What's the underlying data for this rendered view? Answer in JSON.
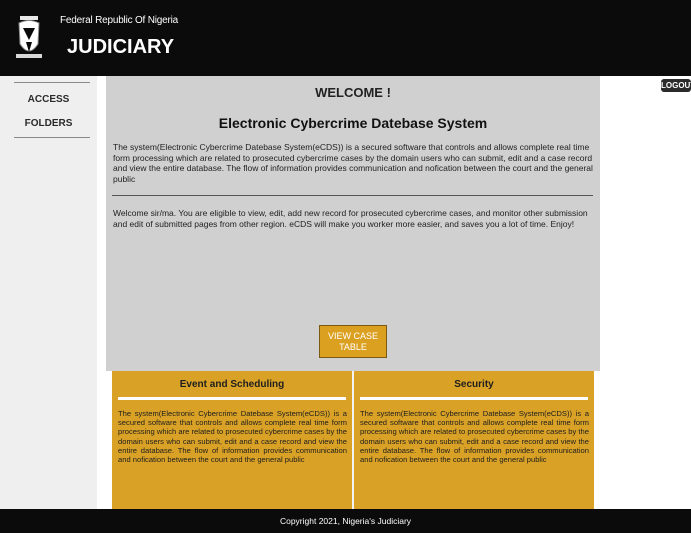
{
  "header": {
    "republic": "Federal Republic Of Nigeria",
    "brand": "JUDICIARY",
    "crest_icon": "coat-of-arms-icon"
  },
  "sidebar": {
    "items": [
      {
        "label": "ACCESS"
      },
      {
        "label": "FOLDERS"
      }
    ]
  },
  "logout_label": "LOGOUT",
  "main": {
    "welcome": "WELCOME !",
    "system_title": "Electronic Cybercrime Datebase System",
    "description": "The system(Electronic Cybercrime Datebase System(eCDS)) is a secured software that controls and allows complete real time form processing which are related to prosecuted cybercrime cases by the domain users who can submit, edit and a case record and view the entire database. The flow of information provides communication and nofication between the court and the general public",
    "welcome_message": "Welcome sir/ma. You are eligible to view, edit, add new record for prosecuted cybercrime cases, and monitor other submission and edit of submitted pages from other region. eCDS will make you worker more easier, and saves you a lot of time. Enjoy!",
    "view_button_line1": "VIEW CASE",
    "view_button_line2": "TABLE"
  },
  "cards": [
    {
      "title": "Event and Scheduling",
      "text": "The system(Electronic Cybercrime Datebase System(eCDS)) is a secured software that controls and allows complete real time form processing which are related to prosecuted cybercrime cases by the domain users who can submit, edit and a case record and view the entire database. The flow of information provides communication and nofication between the court and the general public"
    },
    {
      "title": "Security",
      "text": "The system(Electronic Cybercrime Datebase System(eCDS)) is a secured software that controls and allows complete real time form processing which are related to prosecuted cybercrime cases by the domain users who can submit, edit and a case record and view the entire database. The flow of information provides communication and nofication between the court and the general public"
    }
  ],
  "footer": "Copyright 2021, Nigeria's Judiciary",
  "colors": {
    "header_bg": "#0b0b0b",
    "panel_bg": "#d0d0d0",
    "accent_gold": "#d9a126",
    "sidebar_bg": "#efefef"
  }
}
